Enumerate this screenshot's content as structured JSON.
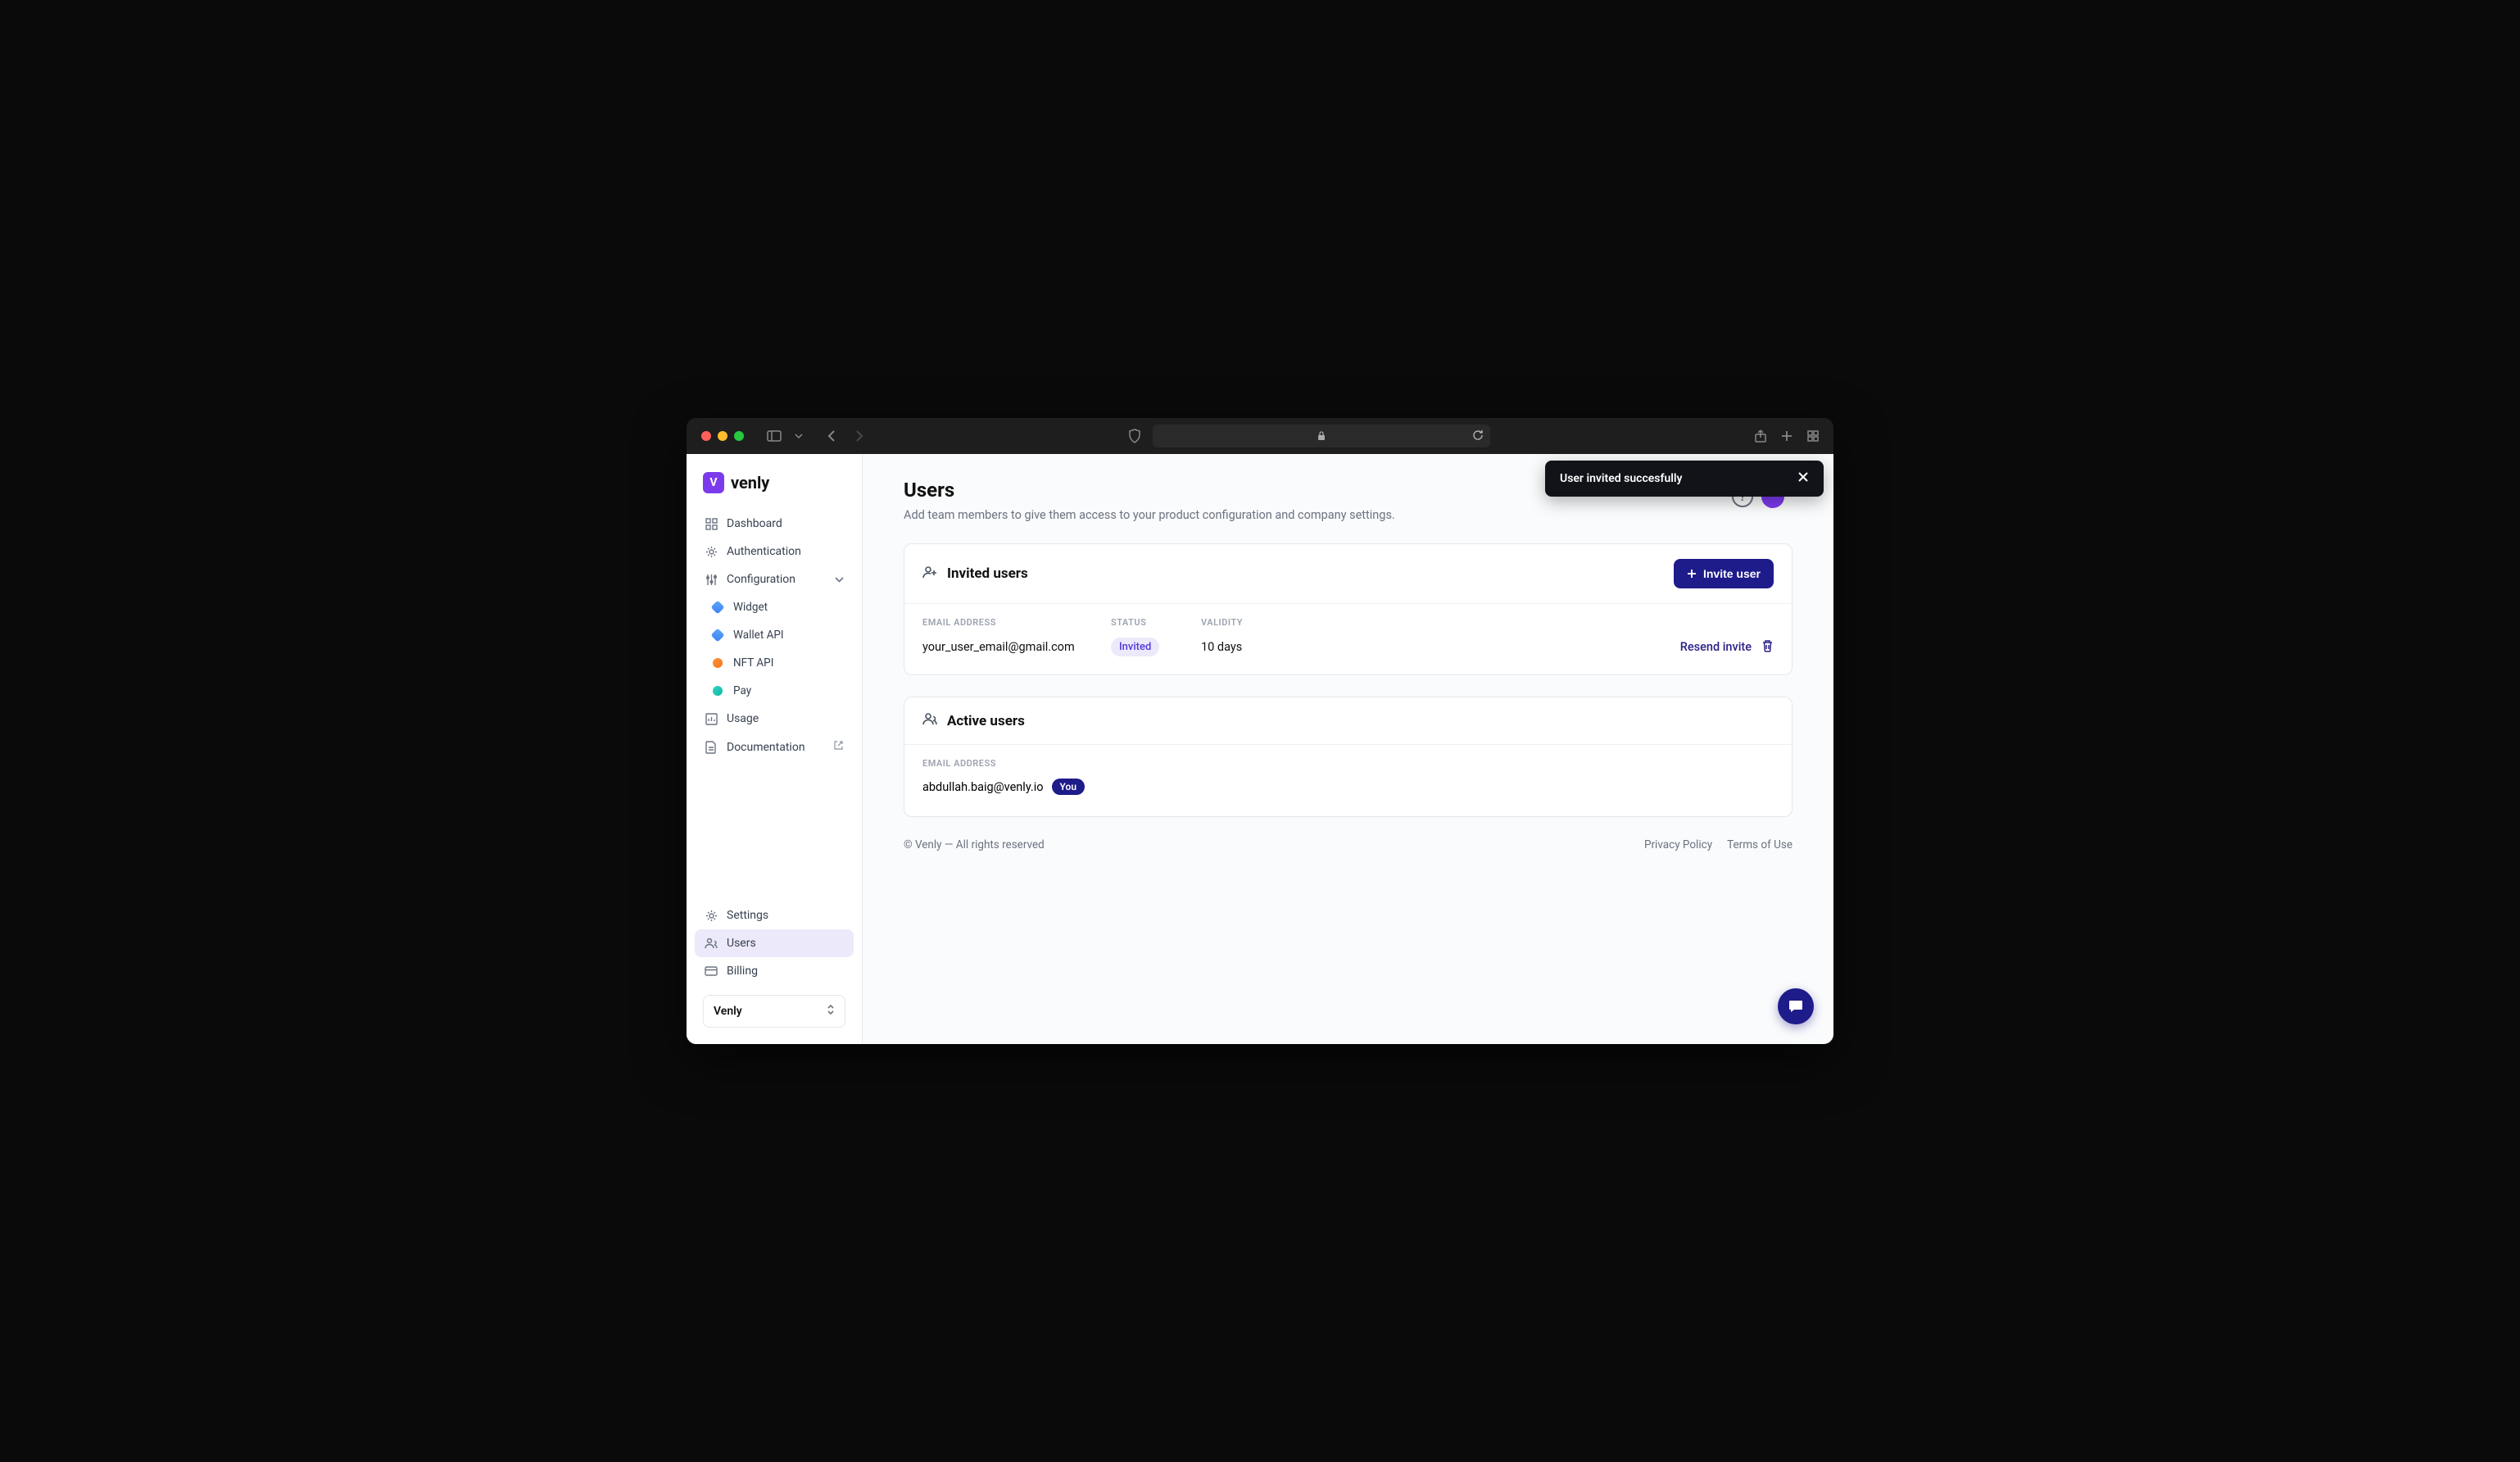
{
  "browser": {
    "traffic_lights": [
      "close",
      "minimize",
      "zoom"
    ]
  },
  "logo": {
    "badge": "V",
    "text": "venly"
  },
  "sidebar": {
    "nav": {
      "dashboard": "Dashboard",
      "authentication": "Authentication",
      "configuration": "Configuration",
      "config_children": {
        "widget": "Widget",
        "wallet_api": "Wallet API",
        "nft_api": "NFT API",
        "pay": "Pay"
      },
      "usage": "Usage",
      "documentation": "Documentation"
    },
    "bottom": {
      "settings": "Settings",
      "users": "Users",
      "billing": "Billing"
    },
    "org": "Venly"
  },
  "page": {
    "title": "Users",
    "subtitle": "Add team members to give them access to your product configuration and company settings."
  },
  "invited": {
    "section_title": "Invited users",
    "invite_button": "Invite user",
    "headers": {
      "email": "EMAIL ADDRESS",
      "status": "STATUS",
      "validity": "VALIDITY"
    },
    "rows": [
      {
        "email": "your_user_email@gmail.com",
        "status": "Invited",
        "validity": "10 days",
        "resend": "Resend invite"
      }
    ]
  },
  "active": {
    "section_title": "Active users",
    "header_email": "EMAIL ADDRESS",
    "rows": [
      {
        "email": "abdullah.baig@venly.io",
        "you_badge": "You"
      }
    ]
  },
  "footer": {
    "copyright": "© Venly — All rights reserved",
    "privacy": "Privacy Policy",
    "terms": "Terms of Use"
  },
  "toast": {
    "message": "User invited succesfully"
  }
}
